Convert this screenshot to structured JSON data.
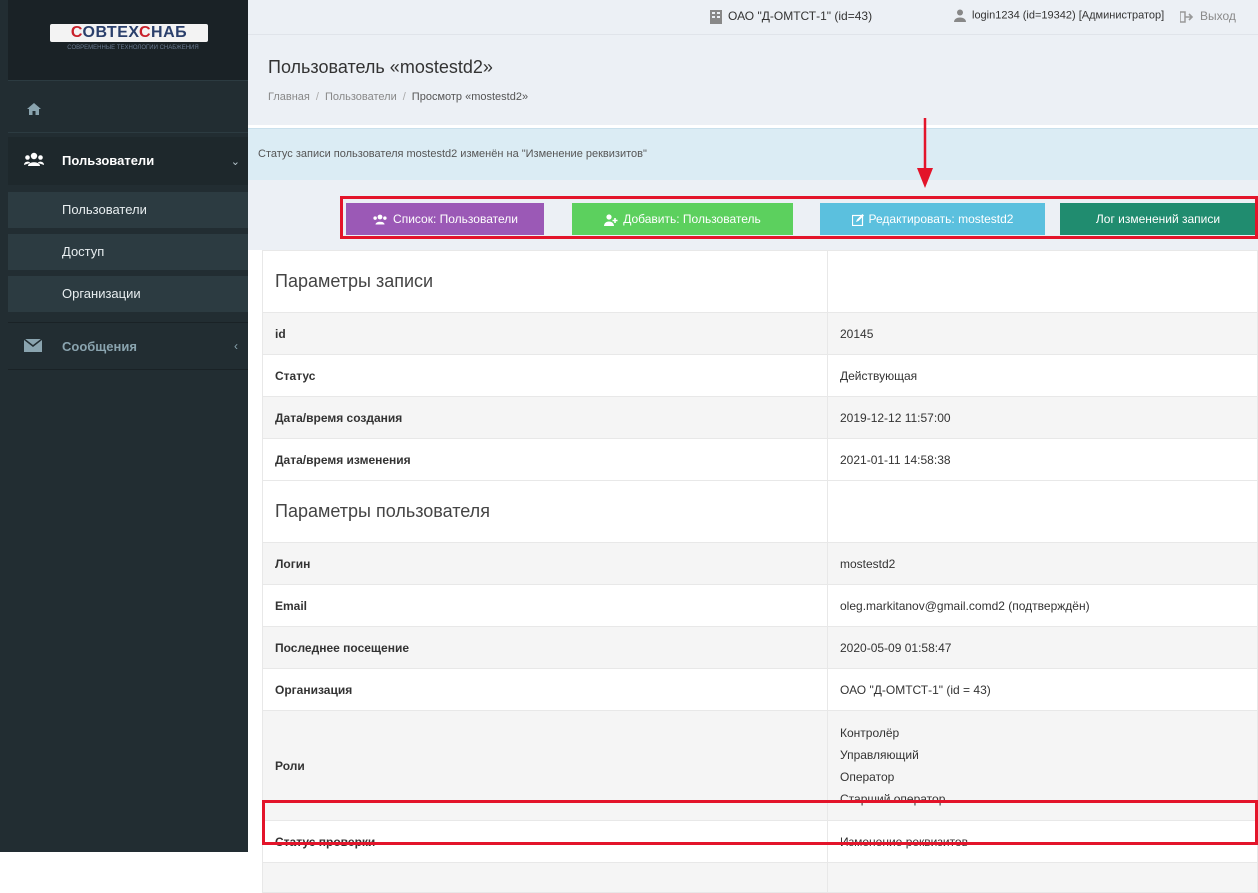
{
  "brand": {
    "logo_text": "СОВТЕХСНАБ",
    "tagline": "СОВРЕМЕННЫЕ ТЕХНОЛОГИИ СНАБЖЕНИЯ"
  },
  "topbar": {
    "organization": "ОАО \"Д-ОМТСТ-1\" (id=43)",
    "user": "login1234 (id=19342) [Администратор]",
    "logout": "Выход"
  },
  "sidebar": {
    "users_label": "Пользователи",
    "sub_items": [
      "Пользователи",
      "Доступ",
      "Организации"
    ],
    "messages_label": "Сообщения"
  },
  "page": {
    "title": "Пользователь «mostestd2»",
    "breadcrumbs": [
      "Главная",
      "Пользователи",
      "Просмотр «mostestd2»"
    ]
  },
  "alert": "Статус записи пользователя mostestd2 изменён на \"Изменение реквизитов\"",
  "buttons": {
    "list": "Список: Пользователи",
    "add": "Добавить: Пользователь",
    "edit": "Редактировать: mostestd2",
    "log": "Лог изменений записи"
  },
  "colors": {
    "purple": "#9b59b6",
    "green": "#5cd05e",
    "blue": "#5bc0de",
    "teal": "#208c6f",
    "highlight": "#e3142a"
  },
  "sections": {
    "record": "Параметры записи",
    "user": "Параметры пользователя"
  },
  "record_rows": [
    {
      "label": "id",
      "value": "20145"
    },
    {
      "label": "Статус",
      "value": "Действующая"
    },
    {
      "label": "Дата/время создания",
      "value": "2019-12-12 11:57:00"
    },
    {
      "label": "Дата/время изменения",
      "value": "2021-01-11 14:58:38"
    }
  ],
  "user_rows": [
    {
      "label": "Логин",
      "value": "mostestd2"
    },
    {
      "label": "Email",
      "value": "oleg.markitanov@gmail.comd2 (подтверждён)"
    },
    {
      "label": "Последнее посещение",
      "value": "2020-05-09 01:58:47"
    },
    {
      "label": "Организация",
      "value": "ОАО \"Д-ОМТСТ-1\" (id = 43)"
    }
  ],
  "roles": {
    "label": "Роли",
    "values": [
      "Контролёр",
      "Управляющий",
      "Оператор",
      "Старший оператор"
    ]
  },
  "verification": {
    "label": "Статус проверки",
    "value": "Изменение реквизитов"
  }
}
